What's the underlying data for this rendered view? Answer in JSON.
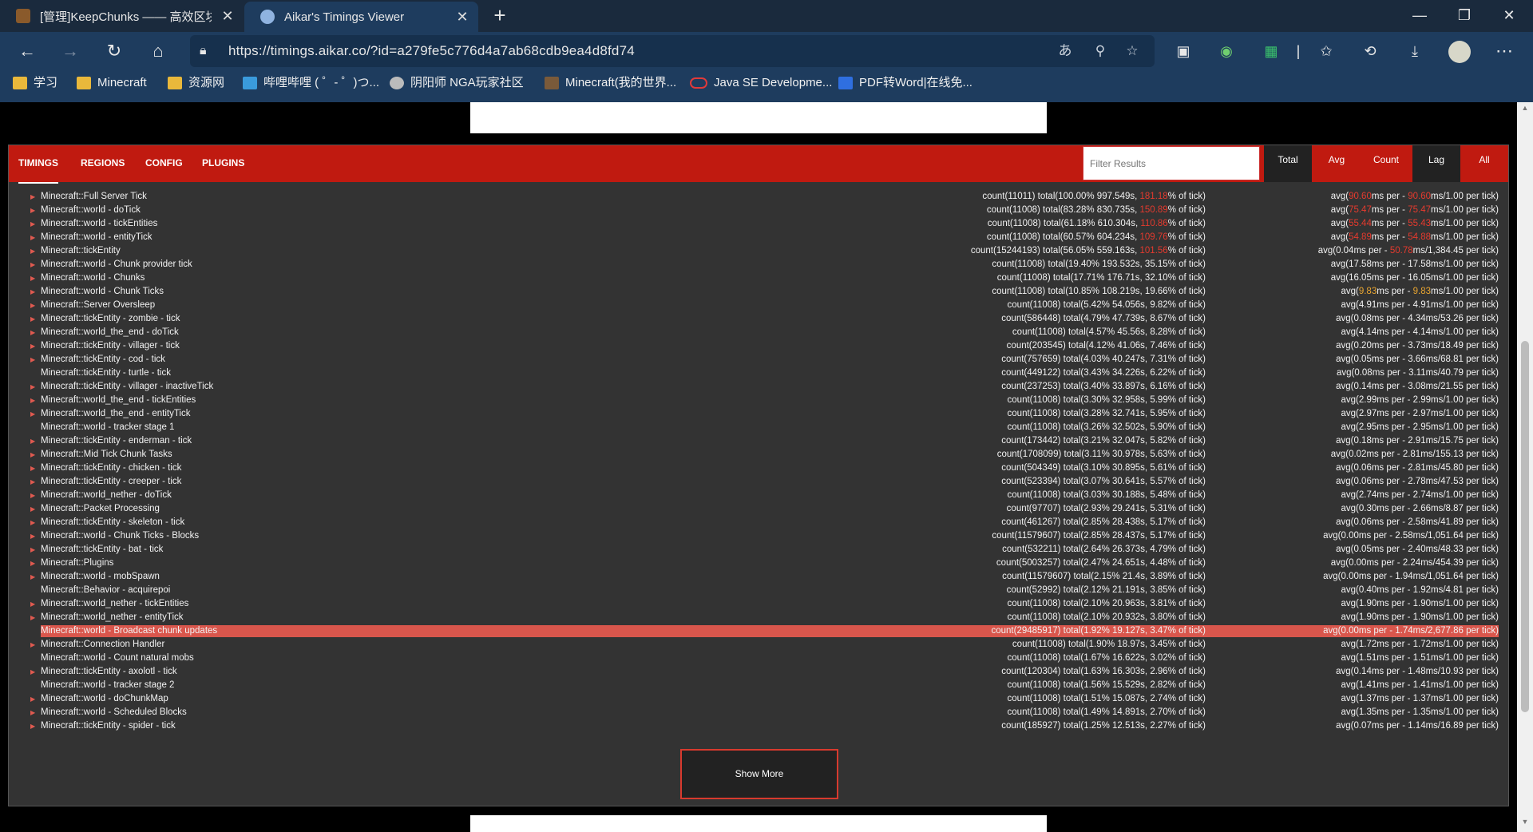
{
  "browser": {
    "tabs": [
      {
        "title": "[管理]KeepChunks —— 高效区块",
        "active": false
      },
      {
        "title": "Aikar's Timings Viewer",
        "active": true
      }
    ],
    "url": "https://timings.aikar.co/?id=a279fe5c776d4a7ab68cdb9ea4d8fd74",
    "bookmarks": [
      {
        "label": "学习",
        "icon": "folder-icon"
      },
      {
        "label": "Minecraft",
        "icon": "folder-icon"
      },
      {
        "label": "资源网",
        "icon": "folder-icon"
      },
      {
        "label": "哔哩哔哩 ( ゜- ゜)つ...",
        "icon": "bilibili-icon"
      },
      {
        "label": "阴阳师 NGA玩家社区",
        "icon": "nga-icon"
      },
      {
        "label": "Minecraft(我的世界...",
        "icon": "minecraft-icon"
      },
      {
        "label": "Java SE Developme...",
        "icon": "oracle-icon"
      },
      {
        "label": "PDF转Word|在线免...",
        "icon": "pdf-icon"
      }
    ]
  },
  "nav": {
    "tabs": [
      "TIMINGS",
      "REGIONS",
      "CONFIG",
      "PLUGINS"
    ],
    "filter_placeholder": "Filter Results",
    "sort_buttons": [
      "Total",
      "Avg",
      "Count"
    ],
    "mode_buttons": [
      "Lag",
      "All"
    ]
  },
  "rows": [
    {
      "expand": true,
      "name": "Minecraft::Full Server Tick",
      "mid": [
        "count(11011)  total(100.00% 997.549s, ",
        "181.18",
        "% of tick)"
      ],
      "mid_color": "red",
      "avg": [
        "avg(",
        "90.60",
        "ms per - ",
        "90.60",
        "ms/1.00 per tick)"
      ],
      "avg_color": "red"
    },
    {
      "expand": true,
      "name": "Minecraft::world - doTick",
      "mid": [
        "count(11008)  total(83.28% 830.735s, ",
        "150.89",
        "% of tick)"
      ],
      "mid_color": "red",
      "avg": [
        "avg(",
        "75.47",
        "ms per - ",
        "75.47",
        "ms/1.00 per tick)"
      ],
      "avg_color": "red"
    },
    {
      "expand": true,
      "name": "Minecraft::world - tickEntities",
      "mid": [
        "count(11008)  total(61.18% 610.304s, ",
        "110.86",
        "% of tick)"
      ],
      "mid_color": "red",
      "avg": [
        "avg(",
        "55.44",
        "ms per - ",
        "55.43",
        "ms/1.00 per tick)"
      ],
      "avg_color": "red"
    },
    {
      "expand": true,
      "name": "Minecraft::world - entityTick",
      "mid": [
        "count(11008)  total(60.57% 604.234s, ",
        "109.76",
        "% of tick)"
      ],
      "mid_color": "red",
      "avg": [
        "avg(",
        "54.89",
        "ms per - ",
        "54.88",
        "ms/1.00 per tick)"
      ],
      "avg_color": "red"
    },
    {
      "expand": true,
      "name": "Minecraft::tickEntity",
      "mid": [
        "count(15244193)  total(56.05% 559.163s, ",
        "101.56",
        "% of tick)"
      ],
      "mid_color": "red",
      "avg": [
        "avg(0.04ms per - ",
        "50.78",
        "ms/1,384.45 per tick)",
        "",
        ""
      ],
      "avg_color": "red"
    },
    {
      "expand": true,
      "name": "Minecraft::world - Chunk provider tick",
      "mid": [
        "count(11008)  total(19.40% 193.532s, 35.15% of tick)",
        "",
        ""
      ],
      "avg": [
        "avg(17.58ms per - 17.58ms/1.00 per tick)",
        "",
        "",
        "",
        ""
      ]
    },
    {
      "expand": true,
      "name": "Minecraft::world - Chunks",
      "mid": [
        "count(11008)  total(17.71% 176.71s, 32.10% of tick)",
        "",
        ""
      ],
      "avg": [
        "avg(16.05ms per - 16.05ms/1.00 per tick)",
        "",
        "",
        "",
        ""
      ]
    },
    {
      "expand": true,
      "name": "Minecraft::world - Chunk Ticks",
      "mid": [
        "count(11008)  total(10.85% 108.219s, 19.66% of tick)",
        "",
        ""
      ],
      "avg": [
        "avg(",
        "9.83",
        "ms per - ",
        "9.83",
        "ms/1.00 per tick)"
      ],
      "avg_color": "orange"
    },
    {
      "expand": true,
      "name": "Minecraft::Server Oversleep",
      "mid": [
        "count(11008)  total(5.42% 54.056s, 9.82% of tick)",
        "",
        ""
      ],
      "avg": [
        "avg(4.91ms per - 4.91ms/1.00 per tick)",
        "",
        "",
        "",
        ""
      ]
    },
    {
      "expand": true,
      "name": "Minecraft::tickEntity - zombie - tick",
      "mid": [
        "count(586448)  total(4.79% 47.739s, 8.67% of tick)",
        "",
        ""
      ],
      "avg": [
        "avg(0.08ms per - 4.34ms/53.26 per tick)",
        "",
        "",
        "",
        ""
      ]
    },
    {
      "expand": true,
      "name": "Minecraft::world_the_end - doTick",
      "mid": [
        "count(11008)  total(4.57% 45.56s, 8.28% of tick)",
        "",
        ""
      ],
      "avg": [
        "avg(4.14ms per - 4.14ms/1.00 per tick)",
        "",
        "",
        "",
        ""
      ]
    },
    {
      "expand": true,
      "name": "Minecraft::tickEntity - villager - tick",
      "mid": [
        "count(203545)  total(4.12% 41.06s, 7.46% of tick)",
        "",
        ""
      ],
      "avg": [
        "avg(0.20ms per - 3.73ms/18.49 per tick)",
        "",
        "",
        "",
        ""
      ]
    },
    {
      "expand": true,
      "name": "Minecraft::tickEntity - cod - tick",
      "mid": [
        "count(757659)  total(4.03% 40.247s, 7.31% of tick)",
        "",
        ""
      ],
      "avg": [
        "avg(0.05ms per - 3.66ms/68.81 per tick)",
        "",
        "",
        "",
        ""
      ]
    },
    {
      "expand": false,
      "name": "Minecraft::tickEntity - turtle - tick",
      "mid": [
        "count(449122)  total(3.43% 34.226s, 6.22% of tick)",
        "",
        ""
      ],
      "avg": [
        "avg(0.08ms per - 3.11ms/40.79 per tick)",
        "",
        "",
        "",
        ""
      ]
    },
    {
      "expand": true,
      "name": "Minecraft::tickEntity - villager - inactiveTick",
      "mid": [
        "count(237253)  total(3.40% 33.897s, 6.16% of tick)",
        "",
        ""
      ],
      "avg": [
        "avg(0.14ms per - 3.08ms/21.55 per tick)",
        "",
        "",
        "",
        ""
      ]
    },
    {
      "expand": true,
      "name": "Minecraft::world_the_end - tickEntities",
      "mid": [
        "count(11008)  total(3.30% 32.958s, 5.99% of tick)",
        "",
        ""
      ],
      "avg": [
        "avg(2.99ms per - 2.99ms/1.00 per tick)",
        "",
        "",
        "",
        ""
      ]
    },
    {
      "expand": true,
      "name": "Minecraft::world_the_end - entityTick",
      "mid": [
        "count(11008)  total(3.28% 32.741s, 5.95% of tick)",
        "",
        ""
      ],
      "avg": [
        "avg(2.97ms per - 2.97ms/1.00 per tick)",
        "",
        "",
        "",
        ""
      ]
    },
    {
      "expand": false,
      "name": "Minecraft::world - tracker stage 1",
      "mid": [
        "count(11008)  total(3.26% 32.502s, 5.90% of tick)",
        "",
        ""
      ],
      "avg": [
        "avg(2.95ms per - 2.95ms/1.00 per tick)",
        "",
        "",
        "",
        ""
      ]
    },
    {
      "expand": true,
      "name": "Minecraft::tickEntity - enderman - tick",
      "mid": [
        "count(173442)  total(3.21% 32.047s, 5.82% of tick)",
        "",
        ""
      ],
      "avg": [
        "avg(0.18ms per - 2.91ms/15.75 per tick)",
        "",
        "",
        "",
        ""
      ]
    },
    {
      "expand": true,
      "name": "Minecraft::Mid Tick Chunk Tasks",
      "mid": [
        "count(1708099)  total(3.11% 30.978s, 5.63% of tick)",
        "",
        ""
      ],
      "avg": [
        "avg(0.02ms per - 2.81ms/155.13 per tick)",
        "",
        "",
        "",
        ""
      ]
    },
    {
      "expand": true,
      "name": "Minecraft::tickEntity - chicken - tick",
      "mid": [
        "count(504349)  total(3.10% 30.895s, 5.61% of tick)",
        "",
        ""
      ],
      "avg": [
        "avg(0.06ms per - 2.81ms/45.80 per tick)",
        "",
        "",
        "",
        ""
      ]
    },
    {
      "expand": true,
      "name": "Minecraft::tickEntity - creeper - tick",
      "mid": [
        "count(523394)  total(3.07% 30.641s, 5.57% of tick)",
        "",
        ""
      ],
      "avg": [
        "avg(0.06ms per - 2.78ms/47.53 per tick)",
        "",
        "",
        "",
        ""
      ]
    },
    {
      "expand": true,
      "name": "Minecraft::world_nether - doTick",
      "mid": [
        "count(11008)  total(3.03% 30.188s, 5.48% of tick)",
        "",
        ""
      ],
      "avg": [
        "avg(2.74ms per - 2.74ms/1.00 per tick)",
        "",
        "",
        "",
        ""
      ]
    },
    {
      "expand": true,
      "name": "Minecraft::Packet Processing",
      "mid": [
        "count(97707)  total(2.93% 29.241s, 5.31% of tick)",
        "",
        ""
      ],
      "avg": [
        "avg(0.30ms per - 2.66ms/8.87 per tick)",
        "",
        "",
        "",
        ""
      ]
    },
    {
      "expand": true,
      "name": "Minecraft::tickEntity - skeleton - tick",
      "mid": [
        "count(461267)  total(2.85% 28.438s, 5.17% of tick)",
        "",
        ""
      ],
      "avg": [
        "avg(0.06ms per - 2.58ms/41.89 per tick)",
        "",
        "",
        "",
        ""
      ]
    },
    {
      "expand": true,
      "name": "Minecraft::world - Chunk Ticks - Blocks",
      "mid": [
        "count(11579607)  total(2.85% 28.437s, 5.17% of tick)",
        "",
        ""
      ],
      "avg": [
        "avg(0.00ms per - 2.58ms/1,051.64 per tick)",
        "",
        "",
        "",
        ""
      ]
    },
    {
      "expand": true,
      "name": "Minecraft::tickEntity - bat - tick",
      "mid": [
        "count(532211)  total(2.64% 26.373s, 4.79% of tick)",
        "",
        ""
      ],
      "avg": [
        "avg(0.05ms per - 2.40ms/48.33 per tick)",
        "",
        "",
        "",
        ""
      ]
    },
    {
      "expand": true,
      "name": "Minecraft::Plugins",
      "mid": [
        "count(5003257)  total(2.47% 24.651s, 4.48% of tick)",
        "",
        ""
      ],
      "avg": [
        "avg(0.00ms per - 2.24ms/454.39 per tick)",
        "",
        "",
        "",
        ""
      ]
    },
    {
      "expand": true,
      "name": "Minecraft::world - mobSpawn",
      "mid": [
        "count(11579607)  total(2.15% 21.4s, 3.89% of tick)",
        "",
        ""
      ],
      "avg": [
        "avg(0.00ms per - 1.94ms/1,051.64 per tick)",
        "",
        "",
        "",
        ""
      ]
    },
    {
      "expand": false,
      "name": "Minecraft::Behavior - acquirepoi",
      "mid": [
        "count(52992)  total(2.12% 21.191s, 3.85% of tick)",
        "",
        ""
      ],
      "avg": [
        "avg(0.40ms per - 1.92ms/4.81 per tick)",
        "",
        "",
        "",
        ""
      ]
    },
    {
      "expand": true,
      "name": "Minecraft::world_nether - tickEntities",
      "mid": [
        "count(11008)  total(2.10% 20.963s, 3.81% of tick)",
        "",
        ""
      ],
      "avg": [
        "avg(1.90ms per - 1.90ms/1.00 per tick)",
        "",
        "",
        "",
        ""
      ]
    },
    {
      "expand": true,
      "name": "Minecraft::world_nether - entityTick",
      "mid": [
        "count(11008)  total(2.10% 20.932s, 3.80% of tick)",
        "",
        ""
      ],
      "avg": [
        "avg(1.90ms per - 1.90ms/1.00 per tick)",
        "",
        "",
        "",
        ""
      ]
    },
    {
      "expand": false,
      "highlight": true,
      "name": "Minecraft::world - Broadcast chunk updates",
      "mid": [
        "count(29485917)  total(1.92% 19.127s, 3.47% of tick)",
        "",
        ""
      ],
      "avg": [
        "avg(0.00ms per - 1.74ms/2,677.86 per tick)",
        "",
        "",
        "",
        ""
      ]
    },
    {
      "expand": true,
      "name": "Minecraft::Connection Handler",
      "mid": [
        "count(11008)  total(1.90% 18.97s, 3.45% of tick)",
        "",
        ""
      ],
      "avg": [
        "avg(1.72ms per - 1.72ms/1.00 per tick)",
        "",
        "",
        "",
        ""
      ]
    },
    {
      "expand": false,
      "name": "Minecraft::world - Count natural mobs",
      "mid": [
        "count(11008)  total(1.67% 16.622s, 3.02% of tick)",
        "",
        ""
      ],
      "avg": [
        "avg(1.51ms per - 1.51ms/1.00 per tick)",
        "",
        "",
        "",
        ""
      ]
    },
    {
      "expand": true,
      "name": "Minecraft::tickEntity - axolotl - tick",
      "mid": [
        "count(120304)  total(1.63% 16.303s, 2.96% of tick)",
        "",
        ""
      ],
      "avg": [
        "avg(0.14ms per - 1.48ms/10.93 per tick)",
        "",
        "",
        "",
        ""
      ]
    },
    {
      "expand": false,
      "name": "Minecraft::world - tracker stage 2",
      "mid": [
        "count(11008)  total(1.56% 15.529s, 2.82% of tick)",
        "",
        ""
      ],
      "avg": [
        "avg(1.41ms per - 1.41ms/1.00 per tick)",
        "",
        "",
        "",
        ""
      ]
    },
    {
      "expand": true,
      "name": "Minecraft::world - doChunkMap",
      "mid": [
        "count(11008)  total(1.51% 15.087s, 2.74% of tick)",
        "",
        ""
      ],
      "avg": [
        "avg(1.37ms per - 1.37ms/1.00 per tick)",
        "",
        "",
        "",
        ""
      ]
    },
    {
      "expand": true,
      "name": "Minecraft::world - Scheduled Blocks",
      "mid": [
        "count(11008)  total(1.49% 14.891s, 2.70% of tick)",
        "",
        ""
      ],
      "avg": [
        "avg(1.35ms per - 1.35ms/1.00 per tick)",
        "",
        "",
        "",
        ""
      ]
    },
    {
      "expand": true,
      "name": "Minecraft::tickEntity - spider - tick",
      "mid": [
        "count(185927)  total(1.25% 12.513s, 2.27% of tick)",
        "",
        ""
      ],
      "avg": [
        "avg(0.07ms per - 1.14ms/16.89 per tick)",
        "",
        "",
        "",
        ""
      ]
    }
  ],
  "show_more_label": "Show More"
}
